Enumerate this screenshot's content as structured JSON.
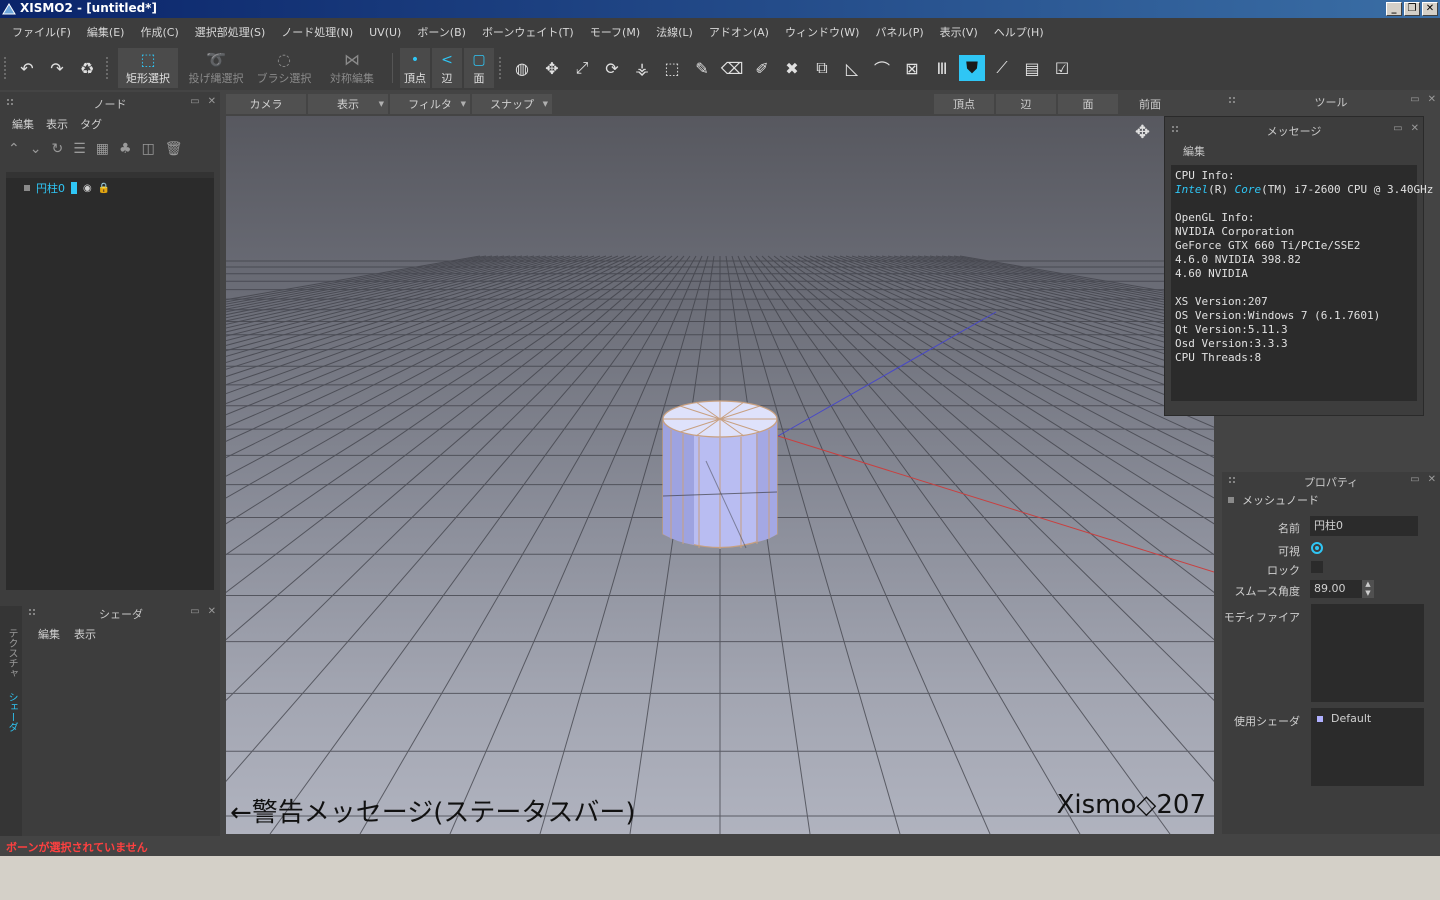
{
  "window": {
    "title": "XISMO2 - [untitled*]",
    "buttons": [
      "_",
      "❐",
      "✕"
    ]
  },
  "menubar": {
    "items": [
      "ファイル(F)",
      "編集(E)",
      "作成(C)",
      "選択部処理(S)",
      "ノード処理(N)",
      "UV(U)",
      "ボーン(B)",
      "ボーンウェイト(T)",
      "モーフ(M)",
      "法線(L)",
      "アドオン(A)",
      "ウィンドウ(W)",
      "パネル(P)",
      "表示(V)",
      "ヘルプ(H)"
    ]
  },
  "toolbar": {
    "select_rect": "矩形選択",
    "select_lasso": "投げ縄選択",
    "select_brush": "ブラシ選択",
    "symmetric_edit": "対称編集",
    "mode_vertex": "頂点",
    "mode_edge": "辺",
    "mode_face": "面"
  },
  "node_panel": {
    "title": "ノード",
    "menu": [
      "編集",
      "表示",
      "タグ"
    ],
    "node_name": "円柱0"
  },
  "shader_panel": {
    "title": "シェーダ",
    "menu": [
      "編集",
      "表示"
    ],
    "side_tab_texture": "テクスチャ",
    "side_tab_shader": "シェーダ"
  },
  "viewport_bar": {
    "camera": "カメラ",
    "display": "表示",
    "filter": "フィルタ",
    "snap": "スナップ",
    "vertex": "頂点",
    "edge": "辺",
    "face": "面",
    "view_name": "前面"
  },
  "viewport": {
    "warning_label": "←警告メッセージ(ステータスバー)",
    "version_label": "Xismo◇207"
  },
  "tool_panel": {
    "title": "ツール"
  },
  "message_panel": {
    "title": "メッセージ",
    "menu_edit": "編集",
    "cpu_info_label": "CPU Info:",
    "cpu_line_intel": "Intel",
    "cpu_line_r": "(R) ",
    "cpu_line_core": "Core",
    "cpu_line_rest": "(TM) i7-2600 CPU @ 3.40GHz",
    "gl_info_label": "OpenGL Info:",
    "gl_vendor": "NVIDIA Corporation",
    "gl_renderer": "GeForce GTX 660 Ti/PCIe/SSE2",
    "gl_version": "4.6.0 NVIDIA 398.82",
    "gl_glsl": "4.60 NVIDIA",
    "xs_version": "XS Version:207",
    "os_version": "OS Version:Windows 7 (6.1.7601)",
    "qt_version": "Qt Version:5.11.3",
    "osd_version": "Osd Version:3.3.3",
    "cpu_threads": "CPU Threads:8"
  },
  "property_panel": {
    "title": "プロパティ",
    "section": "メッシュノード",
    "name_label": "名前",
    "name_value": "円柱0",
    "visible_label": "可視",
    "visible": true,
    "lock_label": "ロック",
    "locked": false,
    "smooth_label": "スムース角度",
    "smooth_value": "89.00",
    "modifier_label": "モディファイア",
    "shader_label": "使用シェーダ",
    "shader_value": "Default"
  },
  "statusbar": {
    "message": "ボーンが選択されていません"
  },
  "colors": {
    "accent": "#2fc6f5",
    "panel_bg": "#3d3d3d",
    "warning": "#ff4040"
  }
}
